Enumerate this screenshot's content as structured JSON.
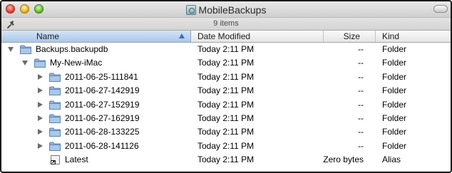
{
  "window": {
    "title": "MobileBackups",
    "status": "9 items"
  },
  "columns": {
    "name": "Name",
    "date": "Date Modified",
    "size": "Size",
    "kind": "Kind"
  },
  "rows": [
    {
      "name": "Backups.backupdb",
      "date": "Today 2:11 PM",
      "size": "--",
      "kind": "Folder",
      "icon": "folder-icon",
      "disclosure": "open"
    },
    {
      "name": "My-New-iMac",
      "date": "Today 2:11 PM",
      "size": "--",
      "kind": "Folder",
      "icon": "folder-icon",
      "disclosure": "open"
    },
    {
      "name": "2011-06-25-111841",
      "date": "Today 2:11 PM",
      "size": "--",
      "kind": "Folder",
      "icon": "folder-icon",
      "disclosure": "closed"
    },
    {
      "name": "2011-06-27-142919",
      "date": "Today 2:11 PM",
      "size": "--",
      "kind": "Folder",
      "icon": "folder-icon",
      "disclosure": "closed"
    },
    {
      "name": "2011-06-27-152919",
      "date": "Today 2:11 PM",
      "size": "--",
      "kind": "Folder",
      "icon": "folder-icon",
      "disclosure": "closed"
    },
    {
      "name": "2011-06-27-162919",
      "date": "Today 2:11 PM",
      "size": "--",
      "kind": "Folder",
      "icon": "folder-icon",
      "disclosure": "closed"
    },
    {
      "name": "2011-06-28-133225",
      "date": "Today 2:11 PM",
      "size": "--",
      "kind": "Folder",
      "icon": "folder-icon",
      "disclosure": "closed"
    },
    {
      "name": "2011-06-28-141126",
      "date": "Today 2:11 PM",
      "size": "--",
      "kind": "Folder",
      "icon": "folder-icon",
      "disclosure": "closed"
    },
    {
      "name": "Latest",
      "date": "Today 2:11 PM",
      "size": "Zero bytes",
      "kind": "Alias",
      "icon": "alias-icon",
      "disclosure": "none"
    }
  ]
}
